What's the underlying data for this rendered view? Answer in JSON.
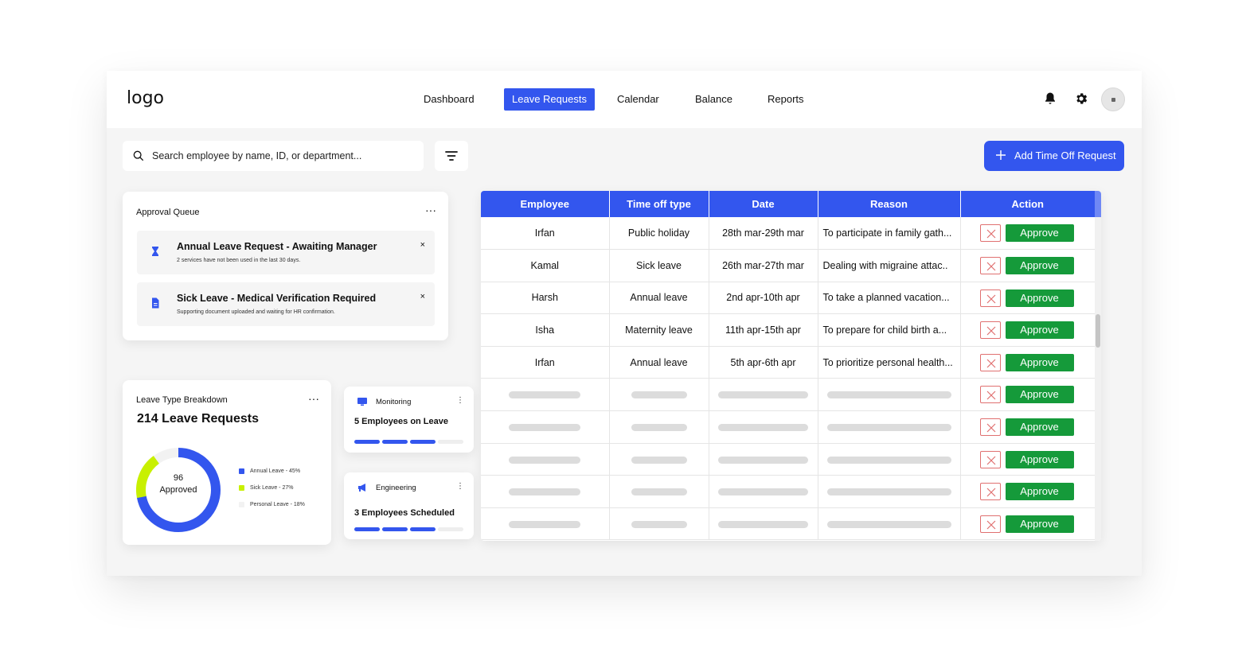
{
  "header": {
    "logo": "logo",
    "nav": [
      "Dashboard",
      "Leave Requests",
      "Calendar",
      "Balance",
      "Reports"
    ],
    "active_nav": "Leave Requests"
  },
  "search": {
    "placeholder": "Search employee by name, ID, or department..."
  },
  "add_button": {
    "label": "Add Time Off Request"
  },
  "approval_queue": {
    "title": "Approval Queue",
    "items": [
      {
        "icon": "hourglass-icon",
        "title": "Annual Leave Request - Awaiting Manager",
        "subtitle": "2 services have not been used in the last 30 days.",
        "close": "×"
      },
      {
        "icon": "document-icon",
        "title": "Sick Leave - Medical Verification Required",
        "subtitle": "Supporting document uploaded and waiting for HR confirmation.",
        "close": "×"
      }
    ]
  },
  "breakdown": {
    "title": "Leave Type Breakdown",
    "count": "214 Leave Requests",
    "center_value": "96",
    "center_label": "Approved",
    "legend": [
      {
        "label": "Annual Leave - 45%",
        "color": "#3356ee",
        "percent": 45
      },
      {
        "label": "Sick Leave - 27%",
        "color": "#c8f000",
        "percent": 27
      },
      {
        "label": "Personal Leave - 18%",
        "color": "#f2f2f2",
        "percent": 18
      }
    ]
  },
  "monitoring": {
    "title": "Monitoring",
    "value": "5 Employees on Leave",
    "progress_segments_filled": 3,
    "progress_segments_total": 4
  },
  "engineering": {
    "title": "Engineering",
    "value": "3 Employees Scheduled",
    "progress_segments_filled": 3,
    "progress_segments_total": 4
  },
  "table": {
    "headers": [
      "Employee",
      "Time off type",
      "Date",
      "Reason",
      "Action"
    ],
    "rows": [
      {
        "employee": "Irfan",
        "type": "Public holiday",
        "date": "28th mar-29th mar",
        "reason": "To participate in family gath..."
      },
      {
        "employee": "Kamal",
        "type": "Sick leave",
        "date": "26th mar-27th mar",
        "reason": "Dealing with migraine attac.."
      },
      {
        "employee": "Harsh",
        "type": "Annual leave",
        "date": "2nd apr-10th apr",
        "reason": "To take a planned vacation..."
      },
      {
        "employee": "Isha",
        "type": "Maternity leave",
        "date": "11th apr-15th apr",
        "reason": "To prepare for child birth a..."
      },
      {
        "employee": "Irfan",
        "type": "Annual leave",
        "date": "5th apr-6th apr",
        "reason": "To prioritize personal health..."
      }
    ],
    "placeholder_rows": 5,
    "approve_label": "Approve"
  },
  "colors": {
    "primary": "#3356ee",
    "approve": "#159a3a",
    "reject_border": "#e07070",
    "accent_lime": "#c8f000"
  }
}
